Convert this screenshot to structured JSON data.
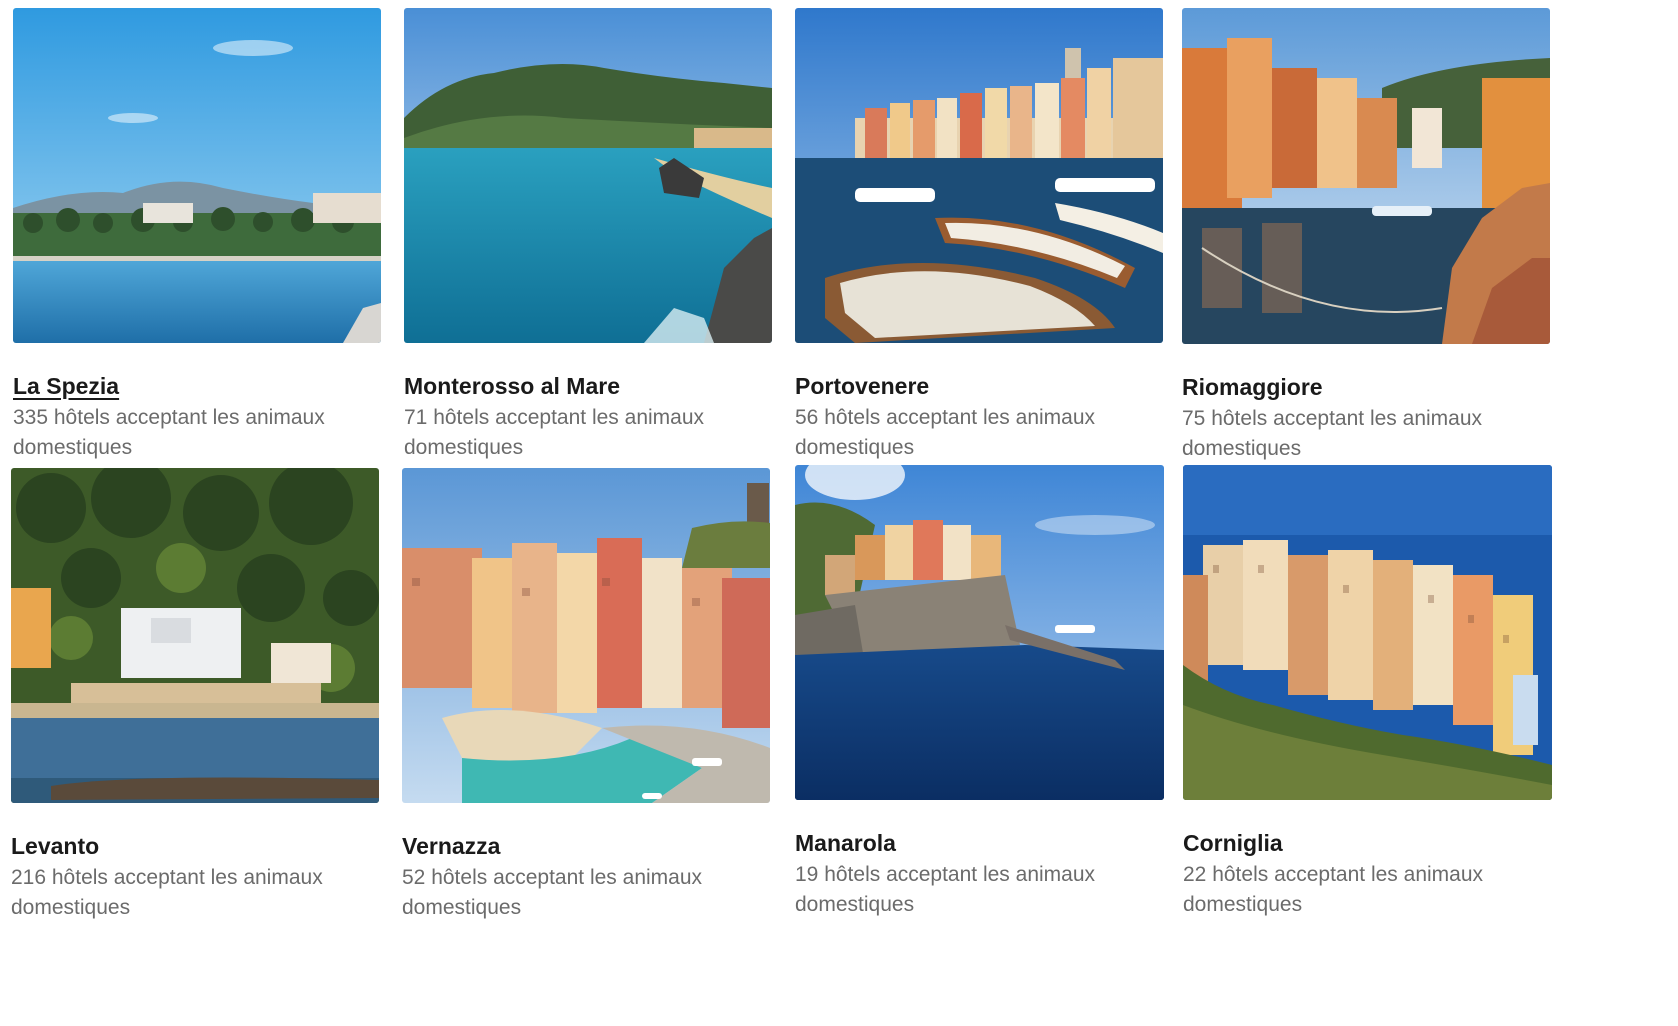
{
  "destinations": [
    {
      "name": "La Spezia",
      "subtitle": "335 hôtels acceptant les animaux domestiques",
      "image_alt": "Bord de mer de La Spezia avec palmiers et montagnes",
      "colors": {
        "sky": "#3aa3e3",
        "sky2": "#8fcdf1",
        "sea": "#2f8cc9",
        "hill": "#6f8a9a"
      }
    },
    {
      "name": "Monterosso al Mare",
      "subtitle": "71 hôtels acceptant les animaux domestiques",
      "image_alt": "Baie de Monterosso al Mare avec eau turquoise et collines vertes",
      "colors": {
        "sky": "#5b9bd8",
        "sky2": "#cfe3f3",
        "sea": "#1f8fb0",
        "hill": "#3f5e3a"
      }
    },
    {
      "name": "Portovenere",
      "subtitle": "56 hôtels acceptant les animaux domestiques",
      "image_alt": "Port de Portovenere avec barques en bois et maisons colorées",
      "colors": {
        "sky": "#3f87d4",
        "sky2": "#9cc4ea",
        "sea": "#1d4f78",
        "hill": "#d8b88a"
      }
    },
    {
      "name": "Riomaggiore",
      "subtitle": "75 hôtels acceptant les animaux domestiques",
      "image_alt": "Petit port de Riomaggiore avec maisons orange et rochers",
      "colors": {
        "sky": "#6fa8dc",
        "sky2": "#d3e6f5",
        "sea": "#27465f",
        "hill": "#c9733a"
      }
    },
    {
      "name": "Levanto",
      "subtitle": "216 hôtels acceptant les animaux domestiques",
      "image_alt": "Plage de Levanto avec colline boisée et villas",
      "colors": {
        "sky": "#3c5a2a",
        "sky2": "#6e8a3a",
        "sea": "#3f6f98",
        "hill": "#2e4a22"
      }
    },
    {
      "name": "Vernazza",
      "subtitle": "52 hôtels acceptant les animaux domestiques",
      "image_alt": "Village de Vernazza avec maisons colorées et petite plage",
      "colors": {
        "sky": "#5b97d6",
        "sky2": "#b9d4ee",
        "sea": "#39b3b0",
        "hill": "#d88e6a"
      }
    },
    {
      "name": "Manarola",
      "subtitle": "19 hôtels acceptant les animaux domestiques",
      "image_alt": "Manarola perché sur un rocher au-dessus de la mer bleue",
      "colors": {
        "sky": "#4f8ed8",
        "sky2": "#a7c8ee",
        "sea": "#0f3a7a",
        "hill": "#8a8072"
      }
    },
    {
      "name": "Corniglia",
      "subtitle": "22 hôtels acceptant les animaux domestiques",
      "image_alt": "Village de Corniglia sur une falaise au-dessus de la mer",
      "colors": {
        "sky": "#1f5fb0",
        "sky2": "#3f7cc8",
        "sea": "#1a56a8",
        "hill": "#5a7a3a"
      }
    }
  ]
}
